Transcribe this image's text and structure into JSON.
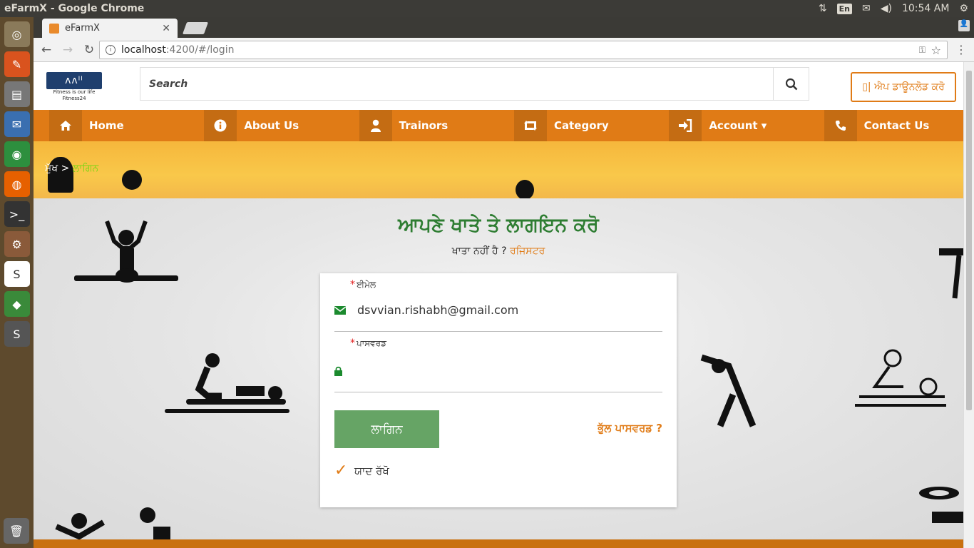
{
  "os": {
    "window_title": "eFarmX - Google Chrome",
    "lang": "En",
    "time": "10:54 AM"
  },
  "browser": {
    "tab_title": "eFarmX",
    "url_host": "localhost",
    "url_path": ":4200/#/login"
  },
  "header": {
    "logo_text": "ᴧᴧᴵᴵ",
    "logo_tagline": "Fitness is our life",
    "logo_sub": "Fitness24",
    "search_placeholder": "Search",
    "app_download": "▯| ਐਪ ਡਾਊਨਲੋਡ ਕਰੋ"
  },
  "nav": {
    "items": [
      {
        "label": "Home",
        "icon": "home-icon"
      },
      {
        "label": "About Us",
        "icon": "info-icon"
      },
      {
        "label": "Trainors",
        "icon": "user-icon"
      },
      {
        "label": "Category",
        "icon": "retweet-icon"
      },
      {
        "label": "Account ▾",
        "icon": "sign-in-icon"
      },
      {
        "label": "Contact Us",
        "icon": "phone-icon"
      }
    ]
  },
  "breadcrumb": {
    "home": "ਮੁੱਖ",
    "separator": ">",
    "current": "ਲਾਗਿਨ"
  },
  "login": {
    "title": "ਆਪਣੇ ਖਾਤੇ ਤੇ ਲਾਗਇਨ ਕਰੋ",
    "no_account": "ਖਾਤਾ ਨਹੀਂ ਹੈ ?",
    "register": "ਰਜਿਸਟਰ",
    "email_label": "ਈਮੇਲ",
    "email_value": "dsvvian.rishabh@gmail.com",
    "password_label": "ਪਾਸਵਰਡ",
    "password_value": "",
    "login_button": "ਲਾਗਿਨ",
    "forgot": "ਭੁੱਲ ਪਾਸਵਰਡ ?",
    "remember": "ਯਾਦ ਰੱਖੋ",
    "remember_checked": true
  },
  "colors": {
    "accent": "#e07b16",
    "heading_green": "#2e7d32",
    "button_green": "#66a465"
  }
}
